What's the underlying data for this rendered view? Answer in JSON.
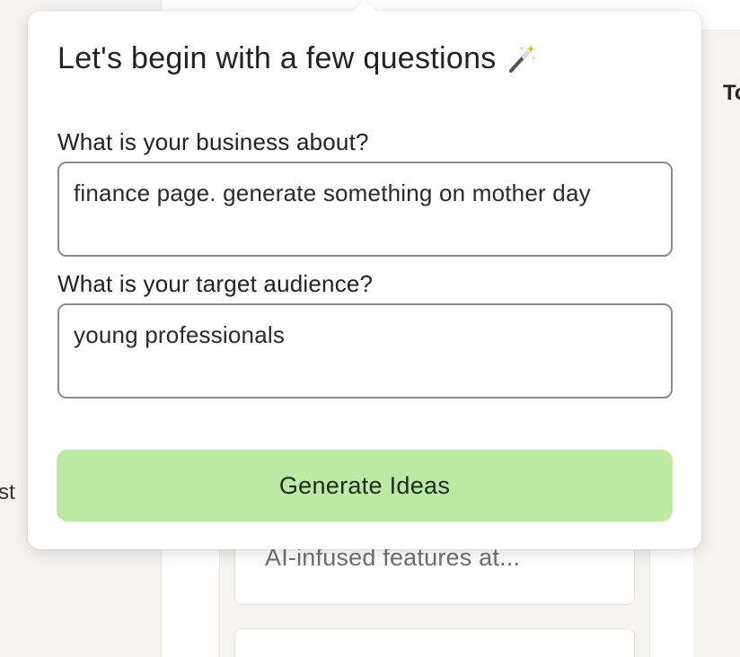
{
  "background": {
    "left_fragment": "st",
    "right_fragment": "To",
    "card_text": "AI-infused features at..."
  },
  "popover": {
    "title": "Let's begin with a few questions",
    "title_icon": "magic-wand-icon",
    "business_label": "What is your business about?",
    "business_value": "finance page. generate something on mother day",
    "audience_label": "What is your target audience?",
    "audience_value": "young professionals",
    "generate_button": "Generate Ideas"
  },
  "colors": {
    "button_bg": "#bce9a3",
    "page_bg": "#f5f4f1",
    "field_border": "#8c8c8c"
  }
}
